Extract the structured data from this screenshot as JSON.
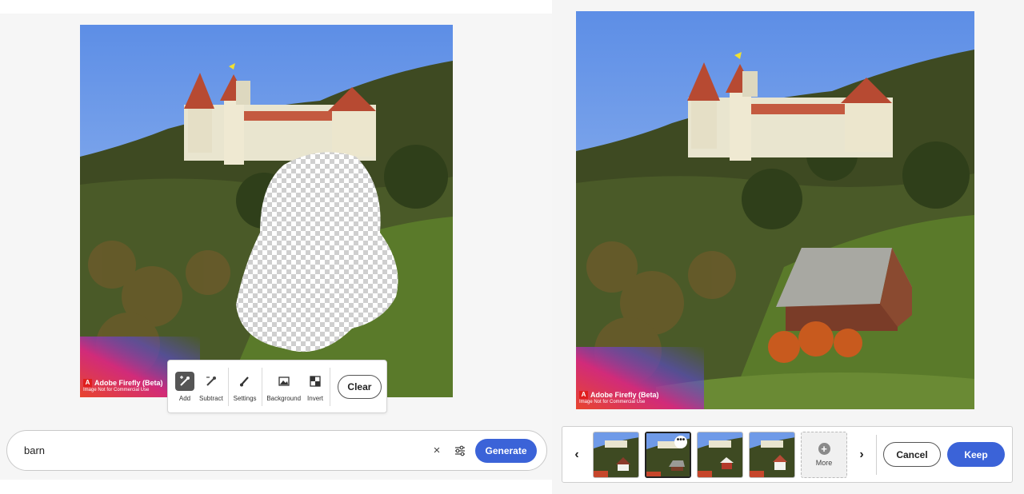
{
  "left": {
    "watermark": {
      "logo": "A",
      "title": "Adobe Firefly (Beta)",
      "subtitle": "Image Not for Commercial Use"
    },
    "toolbar": {
      "tools": [
        {
          "label": "Add",
          "icon": "brush-add-icon"
        },
        {
          "label": "Subtract",
          "icon": "brush-subtract-icon"
        },
        {
          "label": "Settings",
          "icon": "brush-settings-icon"
        },
        {
          "label": "Background",
          "icon": "image-background-icon"
        },
        {
          "label": "Invert",
          "icon": "invert-icon"
        }
      ],
      "clear_label": "Clear"
    },
    "prompt": {
      "value": "barn",
      "clear_glyph": "×",
      "generate_label": "Generate"
    }
  },
  "right": {
    "watermark": {
      "logo": "A",
      "title": "Adobe Firefly (Beta)",
      "subtitle": "Image Not for Commercial Use"
    },
    "variations": {
      "prev_glyph": "‹",
      "next_glyph": "›",
      "selected_index": 1,
      "more_options_glyph": "•••",
      "more_label": "More",
      "more_glyph": "+"
    },
    "cancel_label": "Cancel",
    "keep_label": "Keep"
  },
  "colors": {
    "accent": "#3b63d8",
    "sky": "#6f9ae8",
    "forest": "#3e4a22",
    "meadow": "#5a7a2a",
    "roof_red": "#b74a32"
  }
}
